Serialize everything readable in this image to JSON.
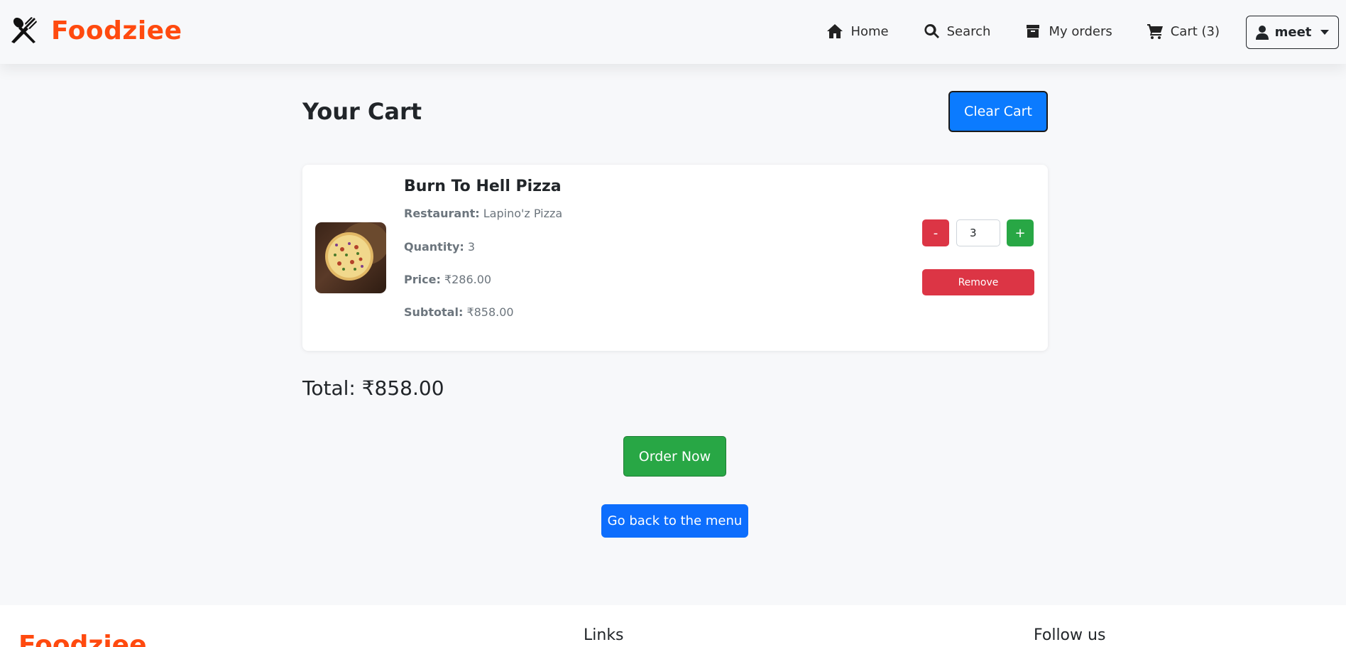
{
  "brand": {
    "name": "Foodziee",
    "color": "#ff4a0f"
  },
  "nav": {
    "links": [
      {
        "label": "Home",
        "icon": "home-icon"
      },
      {
        "label": "Search",
        "icon": "search-icon"
      },
      {
        "label": "My orders",
        "icon": "box-icon"
      },
      {
        "label": "Cart (3)",
        "icon": "cart-icon"
      }
    ],
    "user": {
      "label": "meet",
      "icon": "user-icon"
    }
  },
  "cart": {
    "title": "Your Cart",
    "clear_label": "Clear Cart",
    "item": {
      "name": "Burn To Hell Pizza",
      "restaurant_label": "Restaurant:",
      "restaurant": "Lapino'z Pizza",
      "quantity_label": "Quantity:",
      "quantity": "3",
      "price_label": "Price:",
      "price": "₹286.00",
      "subtotal_label": "Subtotal:",
      "subtotal": "₹858.00",
      "minus_label": "-",
      "plus_label": "+",
      "qty_value": "3",
      "remove_label": "Remove"
    },
    "total": "Total: ₹858.00",
    "order_label": "Order Now",
    "back_label": "Go back to the menu"
  },
  "footer": {
    "logo": "Foodziee",
    "links_heading": "Links",
    "follow_heading": "Follow us"
  },
  "colors": {
    "primary": "#0d6efd",
    "danger": "#dc3545",
    "success": "#28a745"
  }
}
